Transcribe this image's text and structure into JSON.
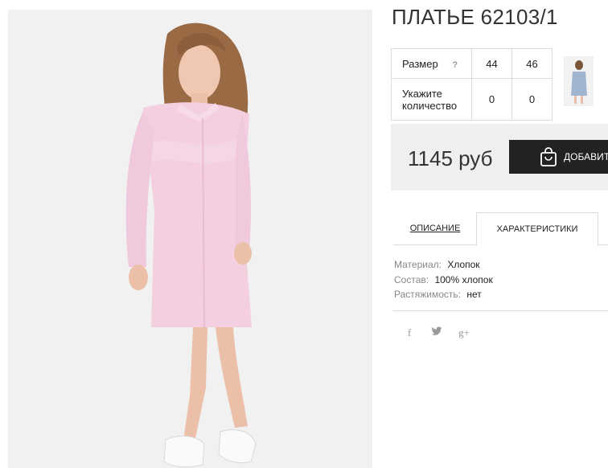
{
  "product": {
    "title": "ПЛАТЬЕ 62103/1"
  },
  "sizes": {
    "label": "Размер",
    "help": "?",
    "options": [
      "44",
      "46"
    ],
    "qty_label": "Укажите количество",
    "quantities": [
      "0",
      "0"
    ]
  },
  "price": {
    "value": "1145 руб",
    "cart_button": "ДОБАВИТЬ"
  },
  "tabs": {
    "description": "ОПИСАНИЕ",
    "characteristics": "ХАРАКТЕРИСТИКИ"
  },
  "specs": [
    {
      "key": "Материал:",
      "value": "Хлопок"
    },
    {
      "key": "Состав:",
      "value": "100% хлопок"
    },
    {
      "key": "Растяжимость:",
      "value": "нет"
    }
  ],
  "social": {
    "facebook": "f",
    "twitter": "t",
    "googleplus": "g+"
  },
  "colors": {
    "dress": "#f3cfe0",
    "dark_button": "#222222",
    "price_bg": "#efefef"
  },
  "icons": [
    "shopping-bag-icon",
    "facebook-icon",
    "twitter-icon",
    "google-plus-icon"
  ]
}
